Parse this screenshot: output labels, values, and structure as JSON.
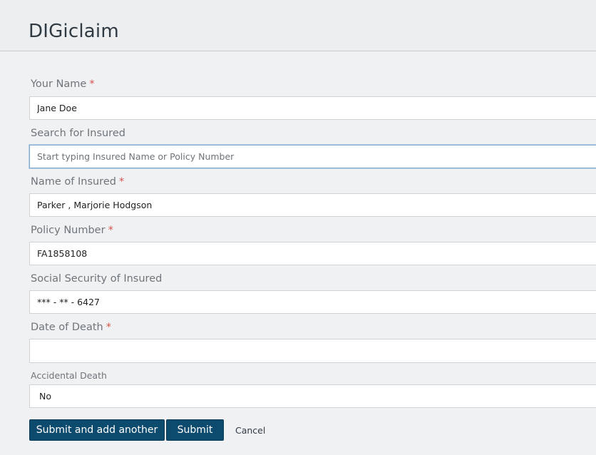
{
  "app": {
    "title": "DIGiclaim"
  },
  "form": {
    "your_name": {
      "label": "Your Name",
      "required_mark": "*",
      "value": "Jane Doe"
    },
    "search_insured": {
      "label": "Search for Insured",
      "placeholder": "Start typing Insured Name or Policy Number",
      "value": ""
    },
    "name_of_insured": {
      "label": "Name of Insured",
      "required_mark": "*",
      "value": "Parker , Marjorie Hodgson"
    },
    "policy_number": {
      "label": "Policy Number",
      "required_mark": "*",
      "value": "FA1858108"
    },
    "ssn": {
      "label": "Social Security of Insured",
      "value": "*** - ** - 6427"
    },
    "date_of_death": {
      "label": "Date of Death",
      "required_mark": "*",
      "value": ""
    },
    "accidental_death": {
      "label": "Accidental Death",
      "value": "No"
    }
  },
  "actions": {
    "submit_add_label": "Submit and add another",
    "submit_label": "Submit",
    "cancel_label": "Cancel"
  }
}
